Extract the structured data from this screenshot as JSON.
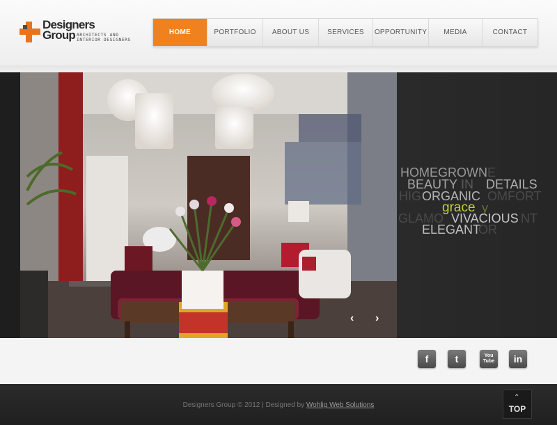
{
  "logo": {
    "name_line1": "Designers",
    "name_line2": "Group",
    "tagline_line1": "Architects and",
    "tagline_line2": "Interior Designers"
  },
  "nav": {
    "items": [
      {
        "label": "HOME",
        "active": true
      },
      {
        "label": "PORTFOLIO",
        "active": false
      },
      {
        "label": "ABOUT US",
        "active": false
      },
      {
        "label": "SERVICES",
        "active": false
      },
      {
        "label": "OPPORTUNITY",
        "active": false
      },
      {
        "label": "MEDIA",
        "active": false
      },
      {
        "label": "CONTACT",
        "active": false
      }
    ],
    "accent": "#f0811f"
  },
  "slider": {
    "prev_symbol": "‹",
    "next_symbol": "›",
    "words": {
      "w1": "HOMEGROWN",
      "w1b": "E",
      "w2": "BEAUTY",
      "w2b": "IN",
      "w3": "DETAILS",
      "w4a": "HIG",
      "w4": "ORGANIC",
      "w4b": "OMFORT",
      "w5": "grace",
      "w5b": "y",
      "w6a": "GLAMO",
      "w6": "VIVACIOUS",
      "w6b": "NT",
      "w7": "ELEGANT",
      "w7b": "OR"
    },
    "highlight_color": "#c3cf3b"
  },
  "social": {
    "icons": [
      {
        "name": "facebook",
        "glyph": "f"
      },
      {
        "name": "twitter",
        "glyph": "t"
      },
      {
        "name": "youtube",
        "glyph": "You\nTube"
      },
      {
        "name": "linkedin",
        "glyph": "in"
      }
    ]
  },
  "footer": {
    "copyright": "Designers Group © 2012 | Designed by ",
    "credit_link": "Wohlig Web Solutions",
    "top_label": "TOP",
    "top_chevron": "⌃"
  }
}
